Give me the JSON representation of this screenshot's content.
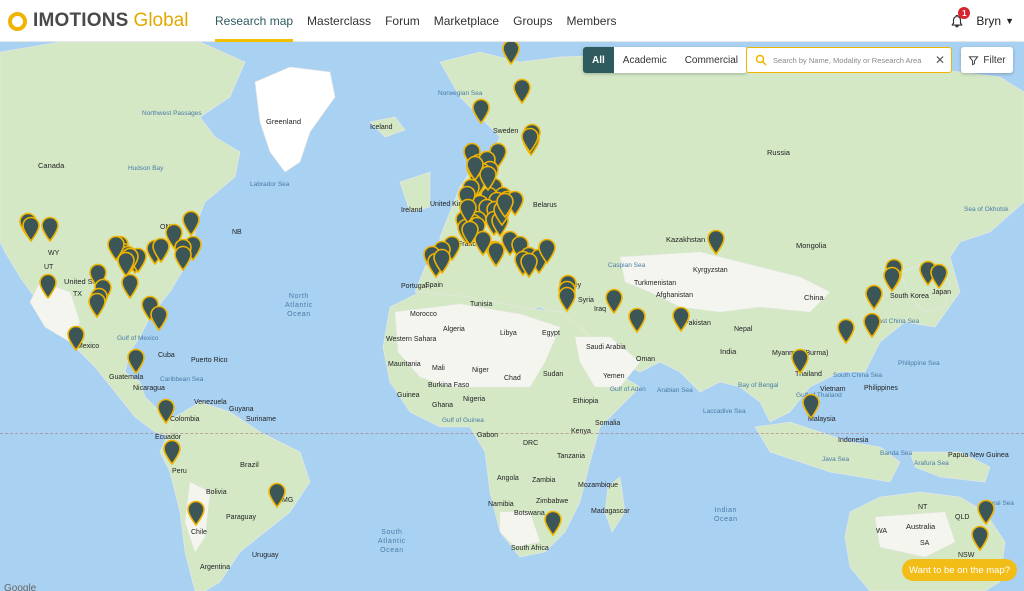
{
  "brand": {
    "name": "IMOTIONS",
    "suffix": "Global",
    "colors": {
      "accent": "#f0b400",
      "teal": "#2f5b5e"
    }
  },
  "nav": {
    "items": [
      {
        "label": "Research map",
        "active": true
      },
      {
        "label": "Masterclass"
      },
      {
        "label": "Forum"
      },
      {
        "label": "Marketplace"
      },
      {
        "label": "Groups"
      },
      {
        "label": "Members"
      }
    ]
  },
  "user": {
    "name": "Bryn",
    "notifications": "1"
  },
  "filters": {
    "segments": [
      {
        "label": "All",
        "active": true
      },
      {
        "label": "Academic"
      },
      {
        "label": "Commercial"
      }
    ],
    "button_label": "Filter"
  },
  "search": {
    "placeholder": "Search by Name, Modality or Research Area",
    "value": ""
  },
  "cta_label": "Want to be on the map?",
  "map": {
    "attribution": "Google",
    "labels": [
      "Greenland",
      "Iceland",
      "Canada",
      "Northwest Passages",
      "Hudson Bay",
      "Labrador Sea",
      "Norwegian Sea",
      "Sweden",
      "Russia",
      "Kazakhstan",
      "Mongolia",
      "China",
      "Sea of Okhotsk",
      "Belarus",
      "United Kingdom",
      "Ireland",
      "France",
      "Portugal",
      "Spain",
      "Morocco",
      "Algeria",
      "Tunisia",
      "Libya",
      "Egypt",
      "Mali",
      "Niger",
      "Chad",
      "Sudan",
      "Mauritania",
      "Western Sahara",
      "Burkina Faso",
      "Guinea",
      "Ghana",
      "Nigeria",
      "Ethiopia",
      "Somalia",
      "Kenya",
      "Gabon",
      "DRC",
      "Tanzania",
      "Angola",
      "Zambia",
      "Mozambique",
      "Madagascar",
      "Zimbabwe",
      "Botswana",
      "Namibia",
      "South Africa",
      "Turkey",
      "Syria",
      "Iraq",
      "Iran",
      "Saudi Arabia",
      "Oman",
      "Yemen",
      "Afghanistan",
      "Turkmenistan",
      "Kyrgyzstan",
      "Pakistan",
      "Nepal",
      "India",
      "Myanmar (Burma)",
      "Thailand",
      "Vietnam",
      "Philippines",
      "South Korea",
      "Japan",
      "East China Sea",
      "South China Sea",
      "Philippine Sea",
      "Bay of Bengal",
      "Arabian Sea",
      "Laccadive Sea",
      "Indonesia",
      "Malaysia",
      "Banda Sea",
      "Papua New Guinea",
      "Arafura Sea",
      "Coral Sea",
      "Australia",
      "United States",
      "Mexico",
      "Gulf of Mexico",
      "Cuba",
      "Puerto Rico",
      "Caribbean Sea",
      "Guatemala",
      "Nicaragua",
      "Venezuela",
      "Colombia",
      "Guyana",
      "Suriname",
      "Ecuador",
      "Peru",
      "Brazil",
      "Bolivia",
      "Paraguay",
      "Chile",
      "Uruguay",
      "Argentina",
      "North Atlantic Ocean",
      "South Atlantic Ocean",
      "Indian Ocean",
      "Gulf of Guinea",
      "Gulf of Aden",
      "Gulf of Thailand",
      "Java Sea",
      "Banda Sea",
      "Caspian Sea",
      "NSW",
      "QLD",
      "WA",
      "SA",
      "NT",
      "NB",
      "ON",
      "WY",
      "UT",
      "TX",
      "MG"
    ],
    "pin_count": 108
  }
}
